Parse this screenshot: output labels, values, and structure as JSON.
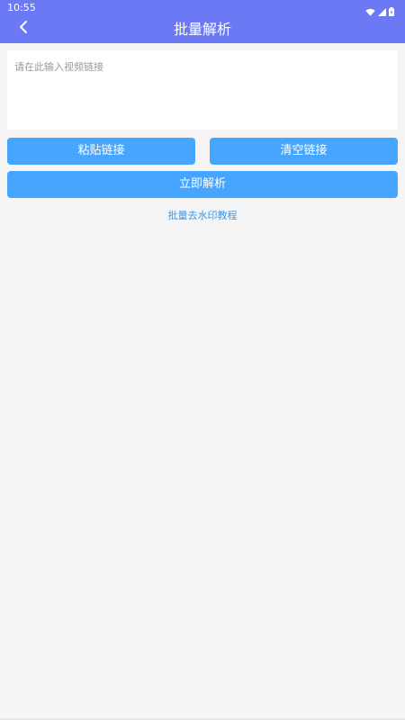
{
  "status_bar": {
    "time": "10:55",
    "icons": [
      "wifi-icon",
      "signal-icon",
      "battery-icon"
    ]
  },
  "header": {
    "title": "批量解析",
    "back_icon": "chevron-left-icon"
  },
  "input": {
    "placeholder": "请在此输入视频链接",
    "value": ""
  },
  "buttons": {
    "paste_label": "粘贴链接",
    "clear_label": "清空链接",
    "parse_label": "立即解析"
  },
  "tutorial": {
    "label": "批量去水印教程"
  },
  "colors": {
    "header": "#6c79f5",
    "button": "#46a6ff",
    "link": "#3a98e6",
    "background": "#f5f5f5"
  }
}
